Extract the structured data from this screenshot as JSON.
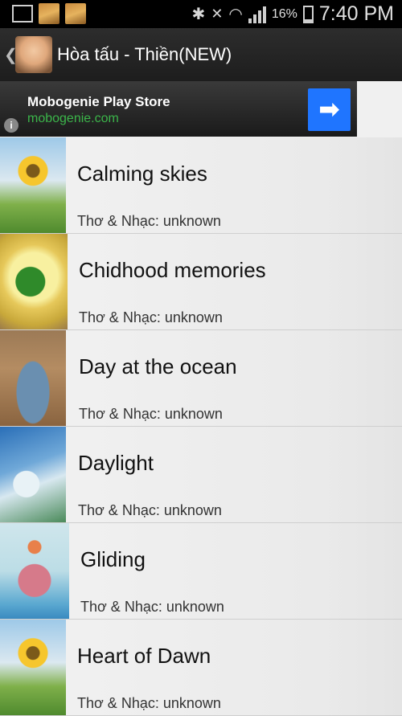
{
  "status_bar": {
    "battery_percent": "16%",
    "time": "7:40 PM",
    "icons": [
      "gallery-icon",
      "cow-app-icon",
      "cow-app-icon",
      "bluetooth-icon",
      "mute-icon",
      "wifi-icon",
      "signal-icon",
      "battery-icon"
    ]
  },
  "action_bar": {
    "back_glyph": "❮",
    "title": "Hòa tấu - Thiền(NEW)"
  },
  "ad": {
    "title": "Mobogenie Play Store",
    "url": "mobogenie.com",
    "info_glyph": "i",
    "arrow_glyph": "➡"
  },
  "songs": [
    {
      "title": "Calming skies",
      "subtitle": "Thơ & Nhạc: unknown"
    },
    {
      "title": "Chidhood memories",
      "subtitle": "Thơ & Nhạc: unknown"
    },
    {
      "title": "Day at the ocean",
      "subtitle": "Thơ & Nhạc: unknown"
    },
    {
      "title": "Daylight",
      "subtitle": "Thơ & Nhạc: unknown"
    },
    {
      "title": "Gliding",
      "subtitle": "Thơ & Nhạc: unknown"
    },
    {
      "title": "Heart of Dawn",
      "subtitle": "Thơ & Nhạc: unknown"
    }
  ]
}
